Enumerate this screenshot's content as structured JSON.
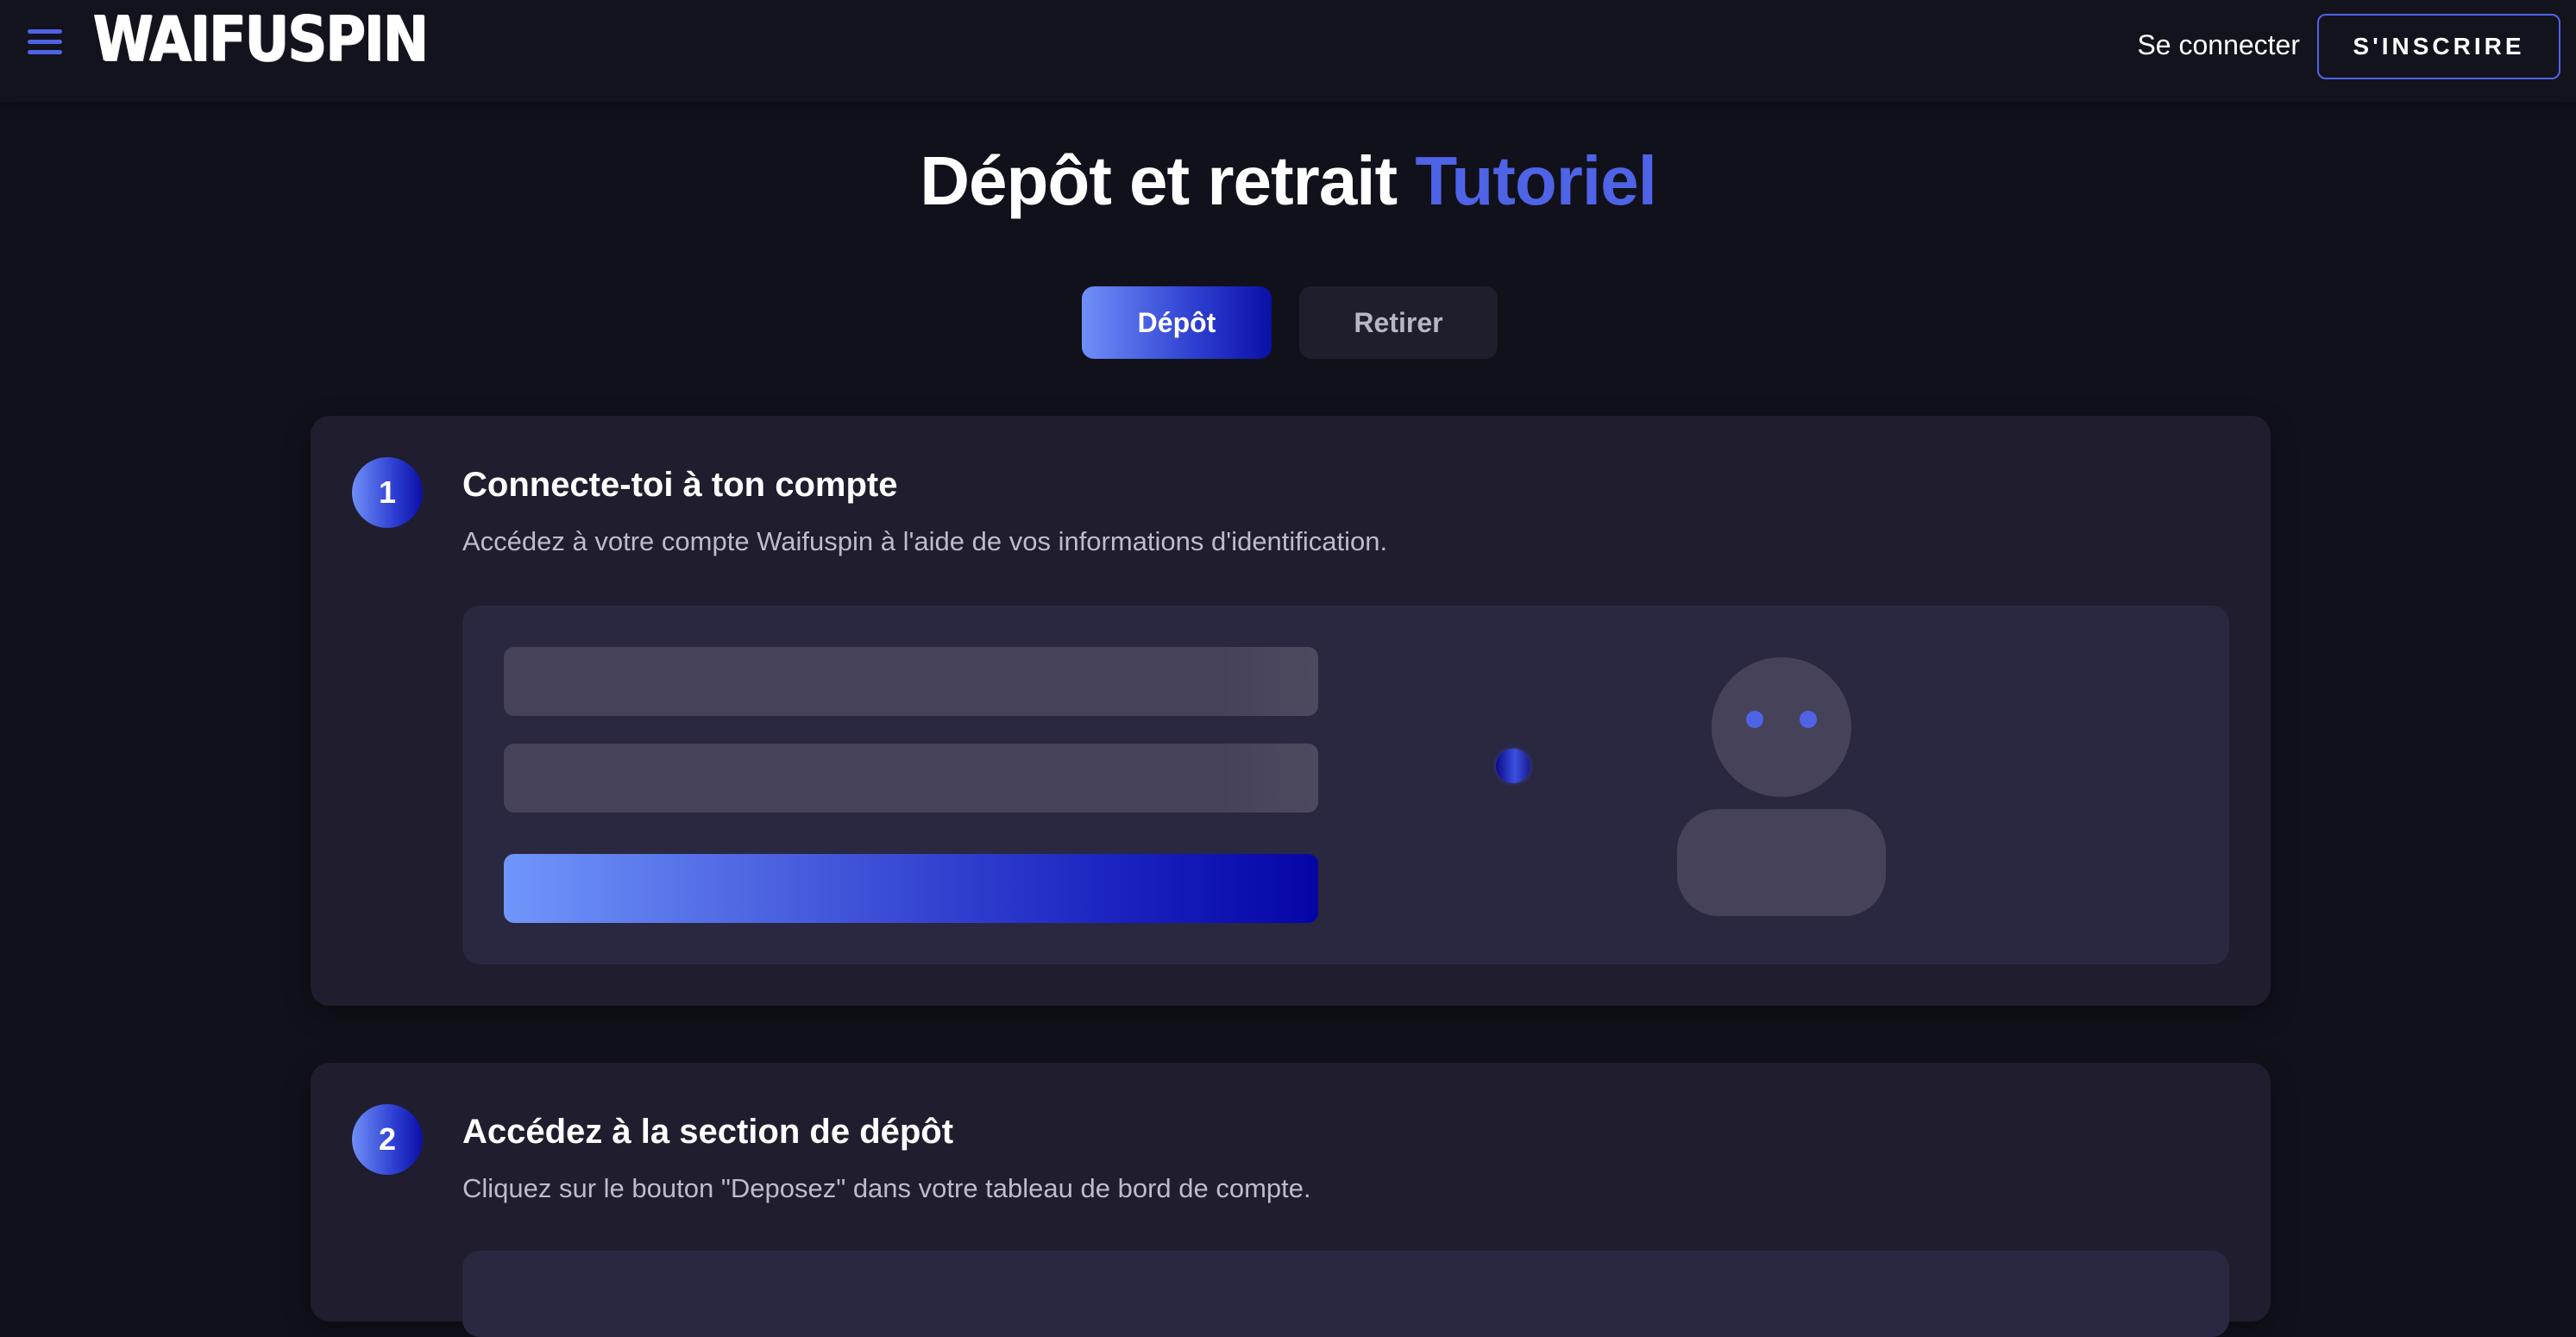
{
  "header": {
    "logo_text": "WAIFUSPIN",
    "login_label": "Se connecter",
    "signup_label": "S'INSCRIRE",
    "menu_icon": "hamburger-menu-icon"
  },
  "page": {
    "title_main": "Dépôt et retrait",
    "title_accent": "Tutoriel"
  },
  "tabs": [
    {
      "label": "Dépôt",
      "active": true
    },
    {
      "label": "Retirer",
      "active": false
    }
  ],
  "steps": [
    {
      "number": "1",
      "title": "Connecte-toi à ton compte",
      "description": "Accédez à votre compte Waifuspin à l'aide de vos informations d'identification."
    },
    {
      "number": "2",
      "title": "Accédez à la section de dépôt",
      "description": "Cliquez sur le bouton \"Deposez\" dans votre tableau de bord de compte."
    }
  ],
  "colors": {
    "accent": "#4f63e6",
    "background": "#11111b",
    "card": "#1f1d2e",
    "panel": "#2a2740"
  }
}
